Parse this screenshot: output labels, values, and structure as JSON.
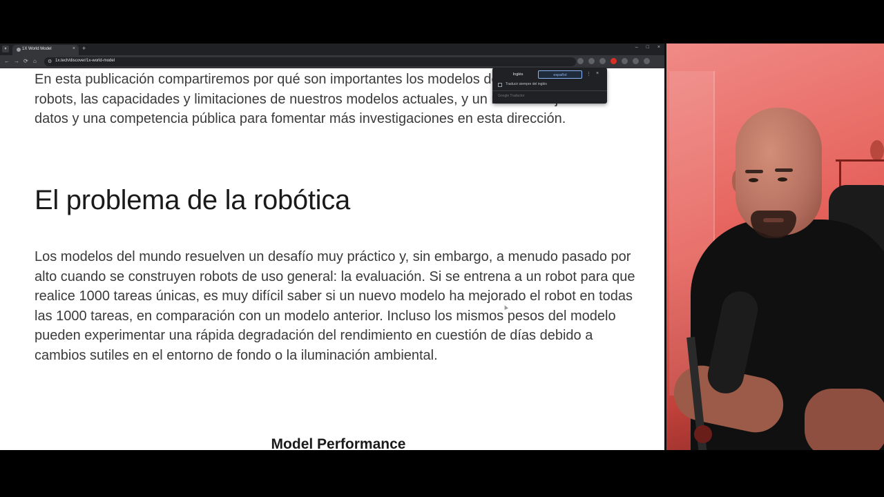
{
  "browser": {
    "tab_title": "1X World Model",
    "tab_close": "×",
    "new_tab": "+",
    "menu_icon": "▾",
    "window_controls": [
      "–",
      "□",
      "×"
    ],
    "nav": {
      "back": "←",
      "forward": "→",
      "reload": "⟳",
      "home": "⌂"
    },
    "url": "1x.tech/discover/1x-world-model",
    "site_info_icon": "⚙"
  },
  "translate_popup": {
    "source_lang": "Inglés",
    "target_lang": "español",
    "more": "⋮",
    "close": "×",
    "checkbox_label": "Traducir siempre del inglés",
    "footer": "Google Traductor"
  },
  "page": {
    "paragraph1": "En esta publicación compartiremos por qué son importantes los modelos del mundo para robots, las capacidades y limitaciones de nuestros modelos actuales, y un nuevo conjunto de datos y una competencia pública para fomentar más investigaciones en esta dirección.",
    "heading": "El problema de la robótica",
    "paragraph2": "Los modelos del mundo resuelven un desafío muy práctico y, sin embargo, a menudo pasado por alto cuando se construyen robots de uso general: la evaluación. Si se entrena a un robot para que realice 1000 tareas únicas, es muy difícil saber si un nuevo modelo ha mejorado el robot en todas las 1000 tareas, en comparación con un modelo anterior. Incluso los mismos pesos del modelo pueden experimentar una rápida degradación del rendimiento en cuestión de días debido a cambios sutiles en el entorno de fondo o la iluminación ambiental.",
    "chart_title": "Model Performance"
  },
  "colors": {
    "page_bg": "#ffffff",
    "text": "#3a3a3a",
    "browser_chrome": "#202124",
    "webcam_bg": "#e6625c"
  }
}
